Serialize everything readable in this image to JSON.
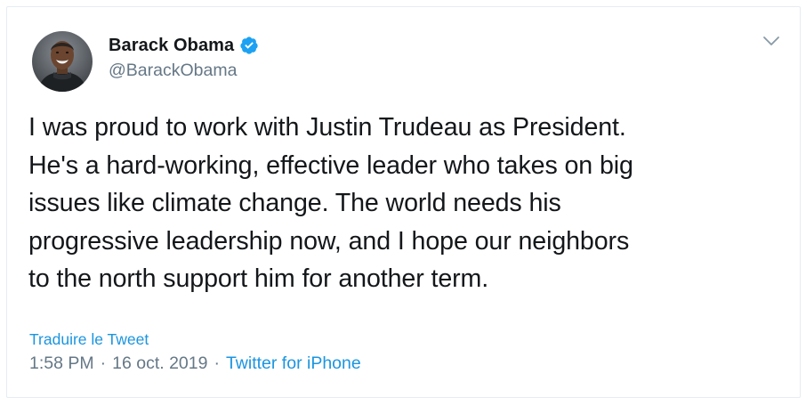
{
  "tweet": {
    "author": {
      "name": "Barack Obama",
      "handle": "@BarackObama",
      "verified": true,
      "avatar_icon": "avatar-photo"
    },
    "text": "I was proud to work with Justin Trudeau as President.\nHe's a hard-working, effective leader who takes on big\nissues like climate change. The world needs his\nprogressive leadership now, and I hope our neighbors\nto the north support him for another term.",
    "translate_label": "Traduire le Tweet",
    "time": "1:58 PM",
    "separator": "·",
    "date": "16 oct. 2019",
    "source": "Twitter for iPhone",
    "menu_icon": "chevron-down-icon"
  },
  "colors": {
    "text": "#14171a",
    "muted": "#657786",
    "link": "#1b95e0",
    "verified": "#1da1f2",
    "border": "#e6ecf0"
  }
}
